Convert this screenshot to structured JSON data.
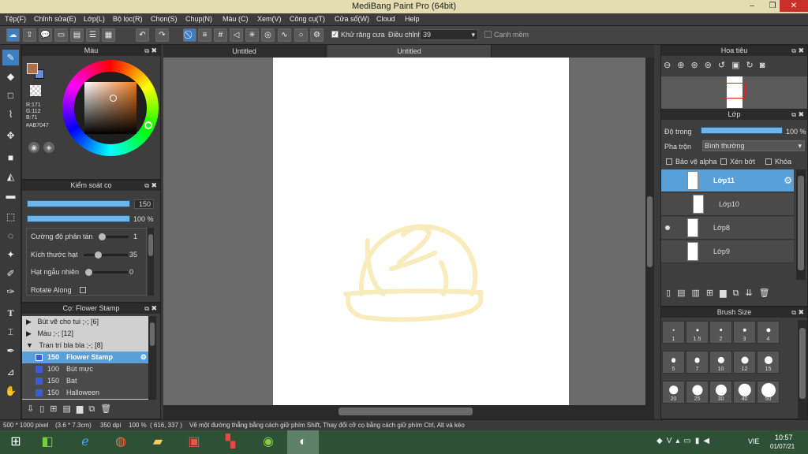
{
  "app": {
    "title": "MediBang Paint Pro (64bit)"
  },
  "menu": [
    "Tệp(F)",
    "Chỉnh sửa(E)",
    "Lớp(L)",
    "Bộ lọc(R)",
    "Chọn(S)",
    "Chụp(N)",
    "Màu (C)",
    "Xem(V)",
    "Công cụ(T)",
    "Cửa sổ(W)",
    "Cloud",
    "Help"
  ],
  "toolbar": {
    "antialias_label": "Khử răng cưa",
    "adjust_label": "Điều chỉnh",
    "adjust_value": "39",
    "soft_edge_label": "Cạnh mềm"
  },
  "color_panel": {
    "title": "Màu",
    "r": "R:171",
    "g": "G:112",
    "b": "B:71",
    "hex": "#AB7047",
    "primary": "#ab7047",
    "secondary": "#6b8dd6"
  },
  "brush_control": {
    "title": "Kiểm soát cọ",
    "size": "150",
    "opacity": "100 %",
    "scatter_label": "Cường độ phân tán",
    "scatter_value": "1",
    "grain_size_label": "Kích thước hạt",
    "grain_size_value": "35",
    "random_grain_label": "Hạt ngẫu nhiên",
    "random_grain_value": "0",
    "rotate_label": "Rotate Along"
  },
  "brush_list": {
    "title": "Cọ: Flower Stamp",
    "groups": [
      "Bút vẽ cho tui ;-; [6]",
      "Màu ;-; [12]",
      "Tran trí bla bla ;-; [8]"
    ],
    "items": [
      {
        "size": "150",
        "name": "Flower Stamp"
      },
      {
        "size": "100",
        "name": "Bút mực"
      },
      {
        "size": "150",
        "name": "Bat"
      },
      {
        "size": "150",
        "name": "Halloween"
      }
    ]
  },
  "tabs": [
    "Untitled",
    "Untitled"
  ],
  "navigator": {
    "title": "Hoa tiêu"
  },
  "layers": {
    "title": "Lớp",
    "opacity_label": "Độ trong",
    "opacity_value": "100 %",
    "blend_label": "Pha trộn",
    "blend_value": "Bình thường",
    "protect_alpha": "Bảo vệ alpha",
    "clipping": "Xén bớt",
    "lock": "Khóa",
    "items": [
      "Lớp11",
      "Lớp10",
      "Lớp8",
      "Lớp9"
    ]
  },
  "brush_size": {
    "title": "Brush Size",
    "sizes": [
      "1",
      "1.5",
      "2",
      "3",
      "4",
      "5",
      "7",
      "10",
      "12",
      "15",
      "20",
      "25",
      "30",
      "40",
      "50"
    ]
  },
  "status": {
    "dimensions": "500 * 1000 pixel",
    "physical": "(3.6 * 7.3cm)",
    "dpi": "350 dpi",
    "zoom": "100 %",
    "coords": "( 616, 337 )",
    "hint": "Vẽ một đường thẳng bằng cách giữ phím Shift, Thay đổi cỡ cọ bằng cách giữ phím Ctrl, Alt và kéo"
  },
  "taskbar": {
    "lang": "VIE",
    "time": "10:57",
    "date": "01/07/21"
  }
}
